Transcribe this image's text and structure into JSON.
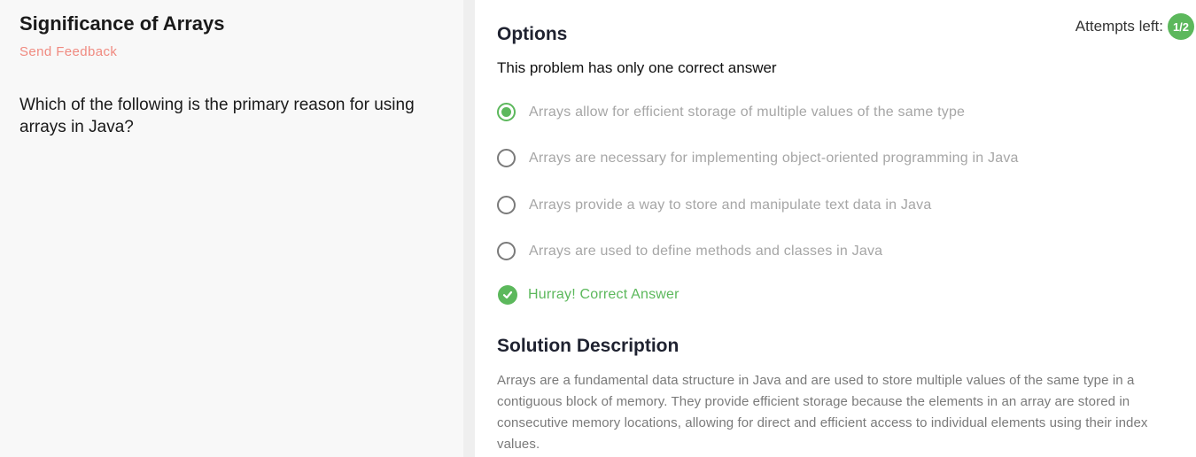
{
  "problem": {
    "title": "Significance of Arrays",
    "feedback_link": "Send Feedback",
    "question": "Which of the following is the primary reason for using arrays in Java?"
  },
  "options_panel": {
    "heading": "Options",
    "attempts_label": "Attempts left:",
    "attempts_value": "1/2",
    "hint": "This problem has only one correct answer",
    "options": [
      {
        "label": "Arrays allow for efficient storage of multiple values of the same type",
        "selected": true
      },
      {
        "label": "Arrays are necessary for implementing object-oriented programming in Java",
        "selected": false
      },
      {
        "label": "Arrays provide a way to store and manipulate text data in Java",
        "selected": false
      },
      {
        "label": "Arrays are used to define methods and classes in Java",
        "selected": false
      }
    ],
    "result_text": "Hurray! Correct Answer"
  },
  "solution": {
    "heading": "Solution Description",
    "text": "Arrays are a fundamental data structure in Java and are used to store multiple values of the same type in a contiguous block of memory. They provide efficient storage because the elements in an array are stored in consecutive memory locations, allowing for direct and efficient access to individual elements using their index values."
  },
  "colors": {
    "accent_green": "#5cb85c",
    "feedback_red": "#f08a80",
    "left_panel_bg": "#f8f8f8"
  },
  "icons": {
    "result": "check-circle-icon",
    "option_selected": "radio-selected-icon",
    "option_unselected": "radio-unselected-icon"
  }
}
